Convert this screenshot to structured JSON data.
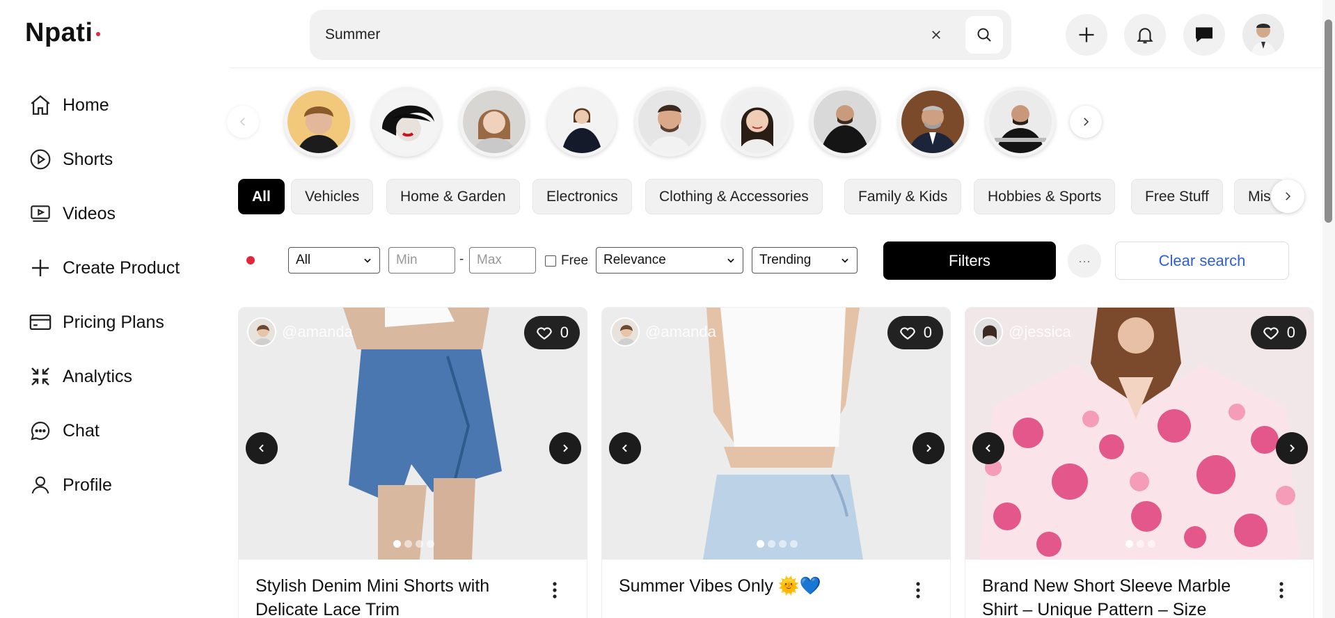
{
  "brand": {
    "name": "Npati",
    "dot_color": "#e0283a"
  },
  "nav": [
    {
      "label": "Home",
      "icon": "home-icon"
    },
    {
      "label": "Shorts",
      "icon": "play-circle-icon"
    },
    {
      "label": "Videos",
      "icon": "video-icon"
    },
    {
      "label": "Create Product",
      "icon": "plus-icon"
    },
    {
      "label": "Pricing Plans",
      "icon": "credit-card-icon"
    },
    {
      "label": "Analytics",
      "icon": "analytics-icon"
    },
    {
      "label": "Chat",
      "icon": "chat-icon"
    },
    {
      "label": "Profile",
      "icon": "user-icon"
    }
  ],
  "search": {
    "value": "Summer "
  },
  "topbar": {
    "icons": [
      "plus-icon",
      "bell-icon",
      "message-icon",
      "avatar"
    ]
  },
  "categories": [
    "All",
    "Vehicles",
    "Home & Garden",
    "Electronics",
    "Clothing & Accessories",
    "Family & Kids",
    "Hobbies & Sports",
    "Free Stuff",
    "Mis"
  ],
  "filters": {
    "category_value": "All",
    "min_placeholder": "Min",
    "max_placeholder": "Max",
    "dash": "-",
    "free_label": "Free",
    "sort_value": "Relevance",
    "mode_value": "Trending",
    "filters_label": "Filters",
    "more_label": "···",
    "clear_label": "Clear search"
  },
  "products": [
    {
      "username": "@amanda",
      "likes": "0",
      "title": "Stylish Denim Mini Shorts with Delicate Lace Trim"
    },
    {
      "username": "@amanda",
      "likes": "0",
      "title": "Summer Vibes Only 🌞💙"
    },
    {
      "username": "@jessica",
      "likes": "0",
      "title": "Brand New Short Sleeve Marble Shirt – Unique Pattern – Size"
    }
  ]
}
